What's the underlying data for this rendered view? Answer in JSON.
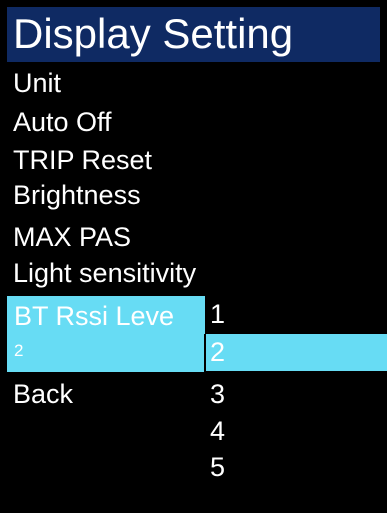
{
  "header": {
    "title": "Display Setting"
  },
  "menu": {
    "items": [
      {
        "label": "Unit"
      },
      {
        "label": "Auto Off"
      },
      {
        "label": "TRIP Reset"
      },
      {
        "label": "Brightness"
      },
      {
        "label": "MAX PAS"
      },
      {
        "label": "Light sensitivity"
      }
    ],
    "selected": {
      "label": "BT Rssi Leve",
      "value": "2"
    },
    "back_label": "Back"
  },
  "dropdown": {
    "options": [
      "1",
      "2",
      "3",
      "4",
      "5"
    ],
    "highlighted_value": "2"
  },
  "colors": {
    "title_bar_bg": "#0f2a63",
    "highlight": "#67dcf4",
    "background": "#000000",
    "text": "#ffffff"
  }
}
